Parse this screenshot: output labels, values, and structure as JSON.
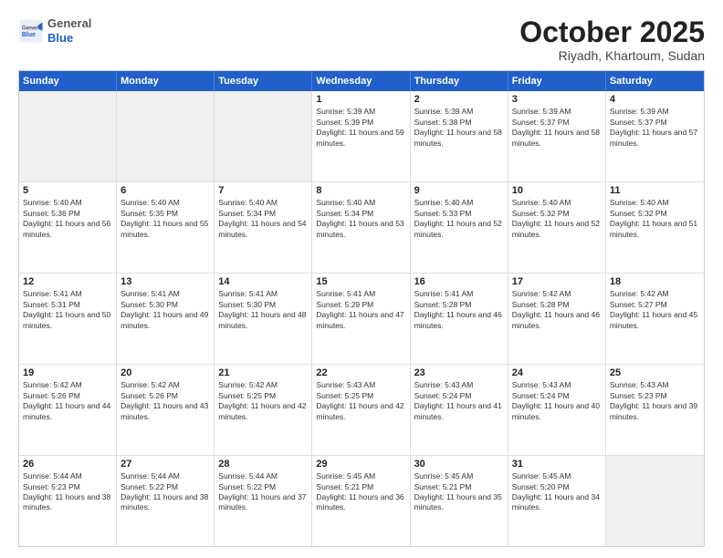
{
  "logo": {
    "general": "General",
    "blue": "Blue"
  },
  "header": {
    "month": "October 2025",
    "location": "Riyadh, Khartoum, Sudan"
  },
  "weekdays": [
    "Sunday",
    "Monday",
    "Tuesday",
    "Wednesday",
    "Thursday",
    "Friday",
    "Saturday"
  ],
  "rows": [
    [
      {
        "day": "",
        "empty": true
      },
      {
        "day": "",
        "empty": true
      },
      {
        "day": "",
        "empty": true
      },
      {
        "day": "1",
        "sunrise": "5:39 AM",
        "sunset": "5:39 PM",
        "daylight": "11 hours and 59 minutes."
      },
      {
        "day": "2",
        "sunrise": "5:39 AM",
        "sunset": "5:38 PM",
        "daylight": "11 hours and 58 minutes."
      },
      {
        "day": "3",
        "sunrise": "5:39 AM",
        "sunset": "5:37 PM",
        "daylight": "11 hours and 58 minutes."
      },
      {
        "day": "4",
        "sunrise": "5:39 AM",
        "sunset": "5:37 PM",
        "daylight": "11 hours and 57 minutes."
      }
    ],
    [
      {
        "day": "5",
        "sunrise": "5:40 AM",
        "sunset": "5:36 PM",
        "daylight": "11 hours and 56 minutes."
      },
      {
        "day": "6",
        "sunrise": "5:40 AM",
        "sunset": "5:35 PM",
        "daylight": "11 hours and 55 minutes."
      },
      {
        "day": "7",
        "sunrise": "5:40 AM",
        "sunset": "5:34 PM",
        "daylight": "11 hours and 54 minutes."
      },
      {
        "day": "8",
        "sunrise": "5:40 AM",
        "sunset": "5:34 PM",
        "daylight": "11 hours and 53 minutes."
      },
      {
        "day": "9",
        "sunrise": "5:40 AM",
        "sunset": "5:33 PM",
        "daylight": "11 hours and 52 minutes."
      },
      {
        "day": "10",
        "sunrise": "5:40 AM",
        "sunset": "5:32 PM",
        "daylight": "11 hours and 52 minutes."
      },
      {
        "day": "11",
        "sunrise": "5:40 AM",
        "sunset": "5:32 PM",
        "daylight": "11 hours and 51 minutes."
      }
    ],
    [
      {
        "day": "12",
        "sunrise": "5:41 AM",
        "sunset": "5:31 PM",
        "daylight": "11 hours and 50 minutes."
      },
      {
        "day": "13",
        "sunrise": "5:41 AM",
        "sunset": "5:30 PM",
        "daylight": "11 hours and 49 minutes."
      },
      {
        "day": "14",
        "sunrise": "5:41 AM",
        "sunset": "5:30 PM",
        "daylight": "11 hours and 48 minutes."
      },
      {
        "day": "15",
        "sunrise": "5:41 AM",
        "sunset": "5:29 PM",
        "daylight": "11 hours and 47 minutes."
      },
      {
        "day": "16",
        "sunrise": "5:41 AM",
        "sunset": "5:28 PM",
        "daylight": "11 hours and 46 minutes."
      },
      {
        "day": "17",
        "sunrise": "5:42 AM",
        "sunset": "5:28 PM",
        "daylight": "11 hours and 46 minutes."
      },
      {
        "day": "18",
        "sunrise": "5:42 AM",
        "sunset": "5:27 PM",
        "daylight": "11 hours and 45 minutes."
      }
    ],
    [
      {
        "day": "19",
        "sunrise": "5:42 AM",
        "sunset": "5:26 PM",
        "daylight": "11 hours and 44 minutes."
      },
      {
        "day": "20",
        "sunrise": "5:42 AM",
        "sunset": "5:26 PM",
        "daylight": "11 hours and 43 minutes."
      },
      {
        "day": "21",
        "sunrise": "5:42 AM",
        "sunset": "5:25 PM",
        "daylight": "11 hours and 42 minutes."
      },
      {
        "day": "22",
        "sunrise": "5:43 AM",
        "sunset": "5:25 PM",
        "daylight": "11 hours and 42 minutes."
      },
      {
        "day": "23",
        "sunrise": "5:43 AM",
        "sunset": "5:24 PM",
        "daylight": "11 hours and 41 minutes."
      },
      {
        "day": "24",
        "sunrise": "5:43 AM",
        "sunset": "5:24 PM",
        "daylight": "11 hours and 40 minutes."
      },
      {
        "day": "25",
        "sunrise": "5:43 AM",
        "sunset": "5:23 PM",
        "daylight": "11 hours and 39 minutes."
      }
    ],
    [
      {
        "day": "26",
        "sunrise": "5:44 AM",
        "sunset": "5:23 PM",
        "daylight": "11 hours and 38 minutes."
      },
      {
        "day": "27",
        "sunrise": "5:44 AM",
        "sunset": "5:22 PM",
        "daylight": "11 hours and 38 minutes."
      },
      {
        "day": "28",
        "sunrise": "5:44 AM",
        "sunset": "5:22 PM",
        "daylight": "11 hours and 37 minutes."
      },
      {
        "day": "29",
        "sunrise": "5:45 AM",
        "sunset": "5:21 PM",
        "daylight": "11 hours and 36 minutes."
      },
      {
        "day": "30",
        "sunrise": "5:45 AM",
        "sunset": "5:21 PM",
        "daylight": "11 hours and 35 minutes."
      },
      {
        "day": "31",
        "sunrise": "5:45 AM",
        "sunset": "5:20 PM",
        "daylight": "11 hours and 34 minutes."
      },
      {
        "day": "",
        "empty": true
      }
    ]
  ]
}
